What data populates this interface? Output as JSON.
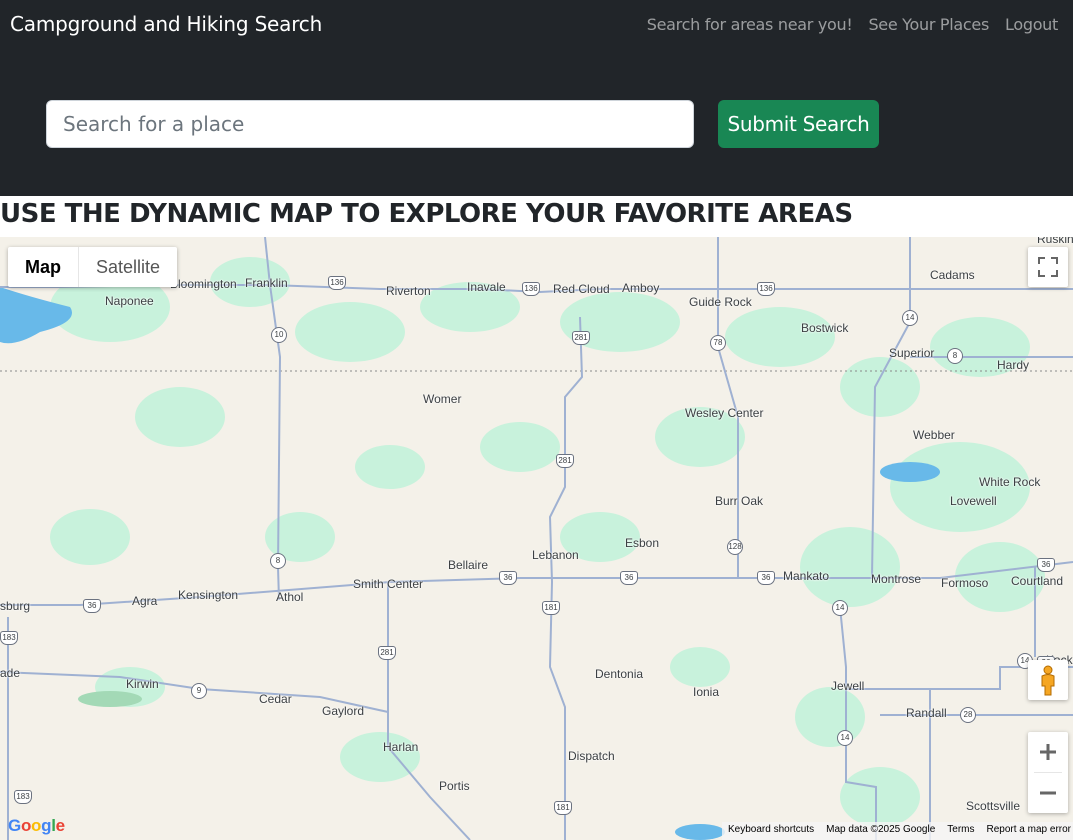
{
  "navbar": {
    "brand": "Campground and Hiking Search",
    "links": [
      "Search for areas near you!",
      "See Your Places",
      "Logout"
    ]
  },
  "search": {
    "placeholder": "Search for a place",
    "value": "",
    "submit_label": "Submit Search"
  },
  "page_heading": "USE THE DYNAMIC MAP TO EXPLORE YOUR FAVORITE AREAS",
  "map": {
    "type_control": {
      "map_label": "Map",
      "satellite_label": "Satellite",
      "selected": "Map"
    },
    "places": [
      "Cadams",
      "Ruskin",
      "Naponee",
      "Bloomington",
      "Franklin",
      "Riverton",
      "Inavale",
      "Red Cloud",
      "Amboy",
      "Guide Rock",
      "Bostwick",
      "Superior",
      "Hardy",
      "Womer",
      "Wesley Center",
      "Webber",
      "White Rock",
      "Lovewell",
      "Burr Oak",
      "Esbon",
      "Lebanon",
      "Bellaire",
      "Smith Center",
      "Mankato",
      "Montrose",
      "Formoso",
      "Courtland",
      "sburg",
      "Agra",
      "Kensington",
      "Athol",
      "Jewell",
      "Randall",
      "Dentonia",
      "Ionia",
      "Kirwin",
      "Cedar",
      "Gaylord",
      "Harlan",
      "Portis",
      "Dispatch",
      "Scottsville",
      "ade",
      "Kack"
    ],
    "route_shields": [
      "136",
      "136",
      "136",
      "281",
      "78",
      "14",
      "8",
      "10",
      "281",
      "128",
      "36",
      "36",
      "36",
      "36",
      "36",
      "14",
      "8",
      "36",
      "183",
      "181",
      "281",
      "9",
      "28",
      "14",
      "14",
      "183",
      "181"
    ],
    "footer": {
      "logo": "Google",
      "keyboard_shortcuts": "Keyboard shortcuts",
      "map_data": "Map data ©2025 Google",
      "terms": "Terms",
      "report": "Report a map error"
    },
    "colors": {
      "land": "#f4f1e9",
      "water": "#68b9e9",
      "park": "#c8f2dc",
      "road": "#9fb1d2"
    }
  }
}
